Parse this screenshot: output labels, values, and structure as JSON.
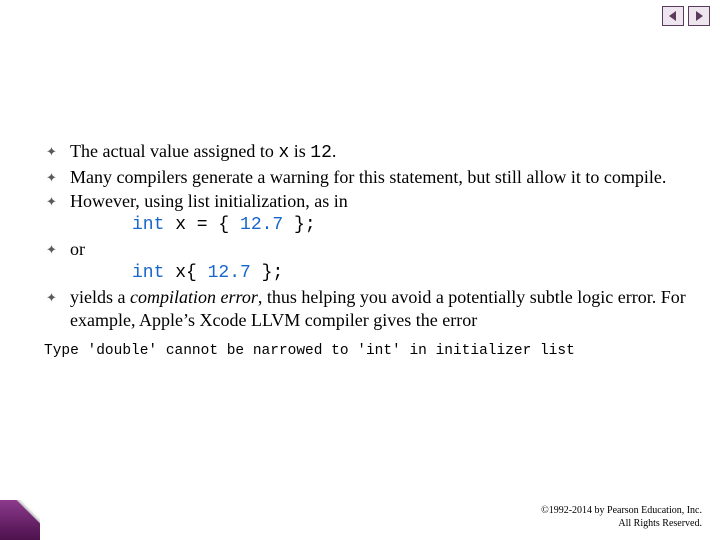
{
  "nav": {
    "prev": "prev-slide",
    "next": "next-slide"
  },
  "bullet_glyph": "✦",
  "bullets": {
    "b1_pre": "The actual value assigned to ",
    "b1_var": "x",
    "b1_mid": " is ",
    "b1_val": "12",
    "b1_post": ".",
    "b2": "Many compilers generate a warning for this statement, but still allow it to compile.",
    "b3": "However, using list initialization, as in",
    "code1_kw": "int",
    "code1_rest": " x = { ",
    "code1_num": "12.7",
    "code1_end": " };",
    "b4": "or",
    "code2_kw": "int",
    "code2_rest": " x{ ",
    "code2_num": "12.7",
    "code2_end": " };",
    "b5_pre": "yields a ",
    "b5_em": "compilation error",
    "b5_post": ", thus helping you avoid a potentially subtle logic error. For example, Apple’s Xcode LLVM compiler gives the error"
  },
  "errline": "Type 'double' cannot be narrowed to 'int' in initializer list",
  "footer": {
    "line1": "©1992-2014 by Pearson Education, Inc.",
    "line2": "All Rights Reserved."
  }
}
